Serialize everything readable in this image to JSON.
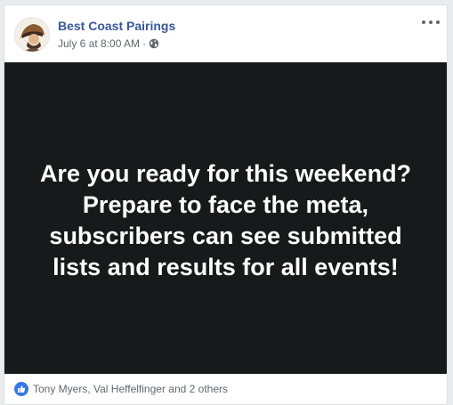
{
  "post": {
    "page_name": "Best Coast Pairings",
    "timestamp": "July 6 at 8:00 AM",
    "separator": "·",
    "image_text": "Are you ready for this weekend? Prepare to face the meta, subscribers can see submitted lists and results for all events!",
    "reactions_text": "Tony Myers, Val Heffelfinger and 2 others"
  },
  "icons": {
    "avatar": "avatar-logo",
    "privacy": "globe-icon",
    "menu": "more-options-icon",
    "reaction": "like-icon"
  },
  "colors": {
    "page_name": "#385898",
    "image_background": "#18191a",
    "like_blue": "#3578e5"
  }
}
